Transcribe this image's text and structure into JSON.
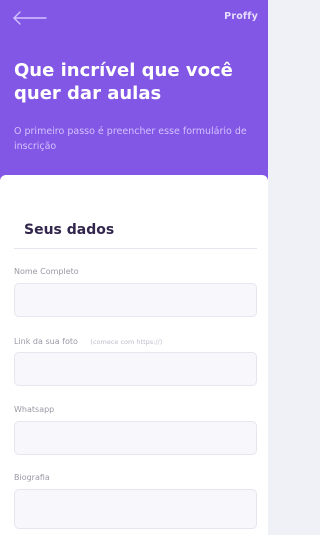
{
  "header": {
    "logo": "Proffy",
    "title": "Que incrível que você quer dar aulas",
    "subtitle": "O primeiro passo é preencher esse formulário de inscrição",
    "back_icon": "arrow-left-icon",
    "background_color": "#8257e5"
  },
  "form": {
    "fieldset_title": "Seus dados",
    "fields": [
      {
        "label": "Nome Completo",
        "value": ""
      },
      {
        "label": "Link da sua foto",
        "hint": "(comece com https://)",
        "value": ""
      },
      {
        "label": "Whatsapp",
        "value": ""
      },
      {
        "label": "Biografia",
        "value": ""
      }
    ]
  }
}
